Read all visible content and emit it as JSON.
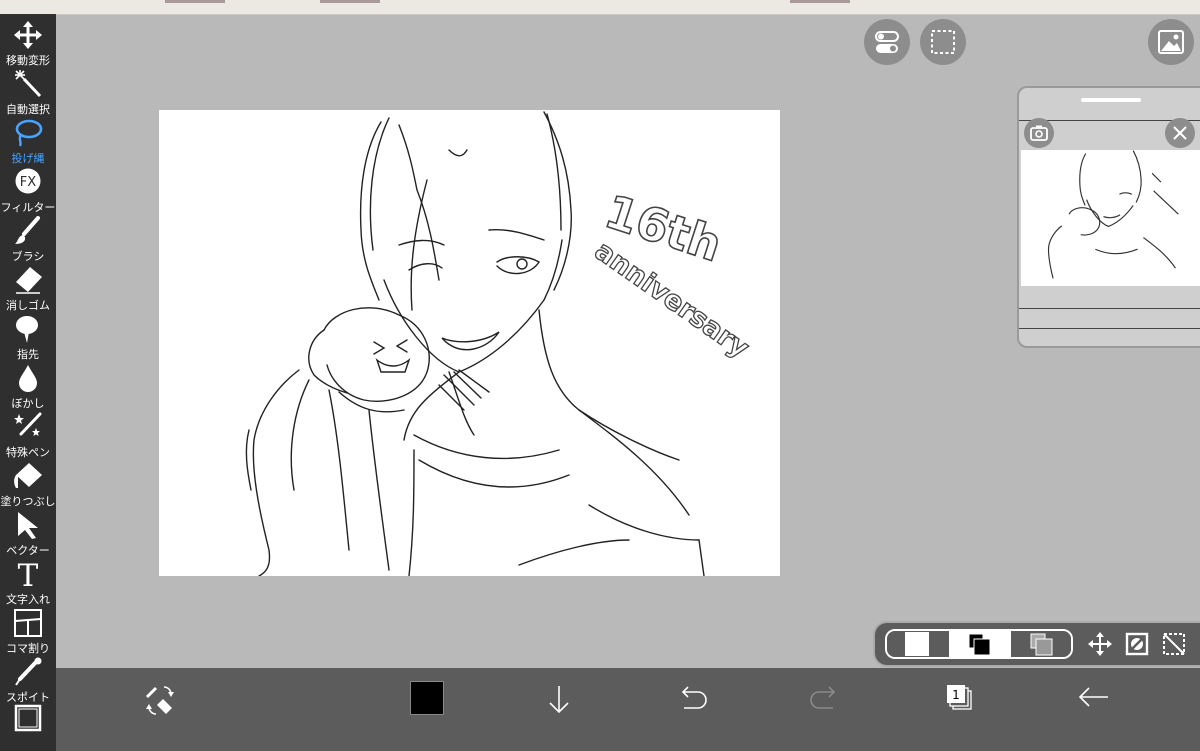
{
  "tools": [
    {
      "id": "move",
      "label": "移動変形",
      "icon": "move-icon"
    },
    {
      "id": "magicwand",
      "label": "自動選択",
      "icon": "magic-wand-icon"
    },
    {
      "id": "lasso",
      "label": "投げ縄",
      "icon": "lasso-icon",
      "active": true
    },
    {
      "id": "filter",
      "label": "フィルター",
      "icon": "fx-icon",
      "icon_text": "FX"
    },
    {
      "id": "brush",
      "label": "ブラシ",
      "icon": "brush-icon"
    },
    {
      "id": "eraser",
      "label": "消しゴム",
      "icon": "eraser-icon"
    },
    {
      "id": "smudge",
      "label": "指先",
      "icon": "smudge-icon"
    },
    {
      "id": "blur",
      "label": "ぼかし",
      "icon": "blur-drop-icon"
    },
    {
      "id": "specialpen",
      "label": "特殊ペン",
      "icon": "special-pen-icon"
    },
    {
      "id": "fill",
      "label": "塗りつぶし",
      "icon": "fill-bucket-icon"
    },
    {
      "id": "vector",
      "label": "ベクター",
      "icon": "vector-arrow-icon"
    },
    {
      "id": "text",
      "label": "文字入れ",
      "icon": "text-icon",
      "icon_text": "T"
    },
    {
      "id": "frame",
      "label": "コマ割り",
      "icon": "frame-divider-icon"
    },
    {
      "id": "eyedropper",
      "label": "スポイト",
      "icon": "eyedropper-icon"
    },
    {
      "id": "canvas",
      "label": "",
      "icon": "canvas-icon"
    }
  ],
  "bottombar": {
    "primary_color": "#000000",
    "layer_count": "1",
    "icons": [
      "swap-pen-eraser-icon",
      "color-swatch",
      "download-arrow-icon",
      "undo-icon",
      "redo-icon",
      "layers-icon",
      "back-arrow-icon"
    ]
  },
  "artwork": {
    "lettering_top": "16th",
    "lettering_bottom": "anniversary"
  },
  "layer_panel": {
    "icons": [
      "white-layer-icon",
      "black-layer-icon",
      "transparent-layer-icon",
      "move-layer-icon",
      "layer-mask-icon",
      "select-layer-icon"
    ]
  },
  "colors": {
    "toolbar_bg": "#2f2f2f",
    "bottombar_bg": "#5c5c5c",
    "workspace_bg": "#b9b9b9",
    "active_tool": "#4aa3ff"
  }
}
